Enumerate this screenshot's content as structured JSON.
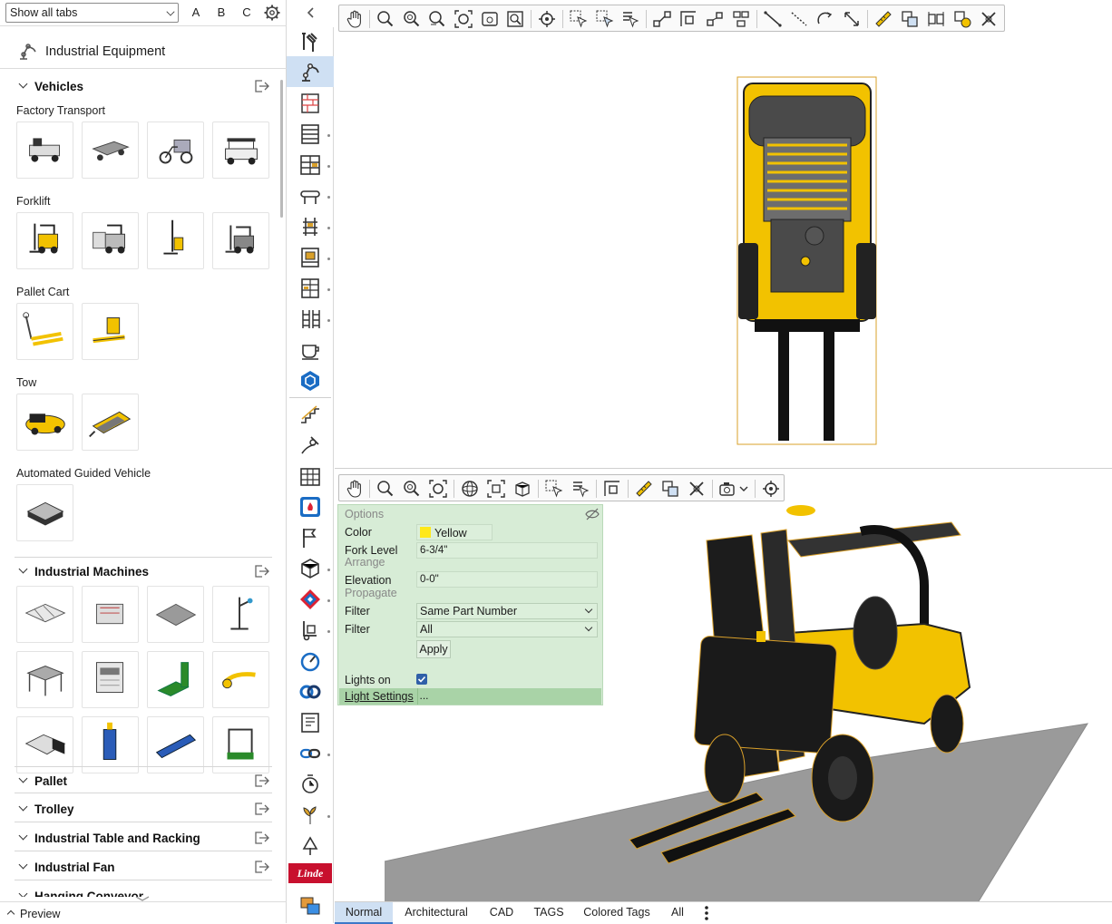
{
  "library": {
    "tab_filter": "Show all tabs",
    "letter_buttons": [
      "A",
      "B",
      "C"
    ],
    "title": "Industrial Equipment",
    "sections": {
      "vehicles": "Vehicles",
      "industrial_machines": "Industrial Machines",
      "pallet": "Pallet",
      "trolley": "Trolley",
      "industrial_table_racking": "Industrial Table and Racking",
      "industrial_fan": "Industrial Fan",
      "partial_next": "Hanging Conveyor"
    },
    "categories": {
      "factory_transport": "Factory Transport",
      "forklift": "Forklift",
      "pallet_cart": "Pallet Cart",
      "tow": "Tow",
      "agv": "Automated Guided Vehicle"
    },
    "preview_label": "Preview"
  },
  "options_panel": {
    "header_options": "Options",
    "color_label": "Color",
    "color_value": "Yellow",
    "color_swatch": "#ffe81a",
    "fork_level_label": "Fork Level",
    "fork_level_value": "6-3/4\"",
    "header_arrange": "Arrange",
    "elevation_label": "Elevation",
    "elevation_value": "0-0\"",
    "header_propagate": "Propagate",
    "filter1_label": "Filter",
    "filter1_value": "Same Part Number",
    "filter2_label": "Filter",
    "filter2_value": "All",
    "apply_label": "Apply",
    "lights_on_label": "Lights on",
    "lights_on_checked": true,
    "light_settings_label": "Light Settings",
    "light_settings_button": "..."
  },
  "view_tabs": [
    "Normal",
    "Architectural",
    "CAD",
    "TAGS",
    "Colored Tags",
    "All"
  ],
  "active_view_tab": "Normal",
  "colors": {
    "accent": "#3c78c8",
    "forklift_yellow": "#f2c200",
    "options_bg": "#d7ecd6",
    "selected_bg": "#cfe0f3"
  }
}
